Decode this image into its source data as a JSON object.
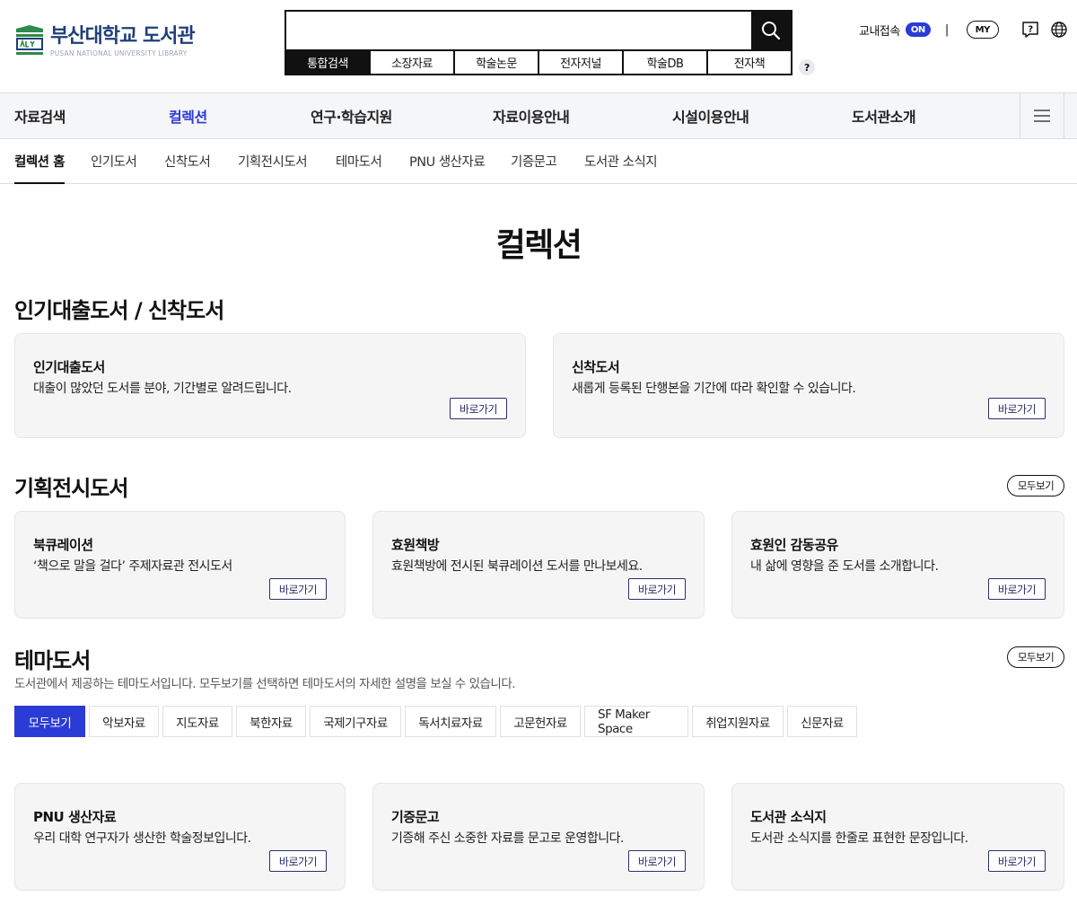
{
  "header": {
    "logo_title": "부산대학교 도서관",
    "logo_subtitle": "PUSAN NATIONAL UNIVERSITY LIBRARY",
    "search": {
      "value": "",
      "placeholder": "",
      "tabs": [
        "통합검색",
        "소장자료",
        "학술논문",
        "전자저널",
        "학술DB",
        "전자책"
      ],
      "active_tab": "통합검색",
      "help": "?"
    },
    "utils": {
      "campus_label": "교내접속",
      "campus_status": "ON",
      "separator": "|",
      "my_label": "MY"
    }
  },
  "gnb": {
    "items": [
      "자료검색",
      "컬렉션",
      "연구·학습지원",
      "자료이용안내",
      "시설이용안내",
      "도서관소개"
    ],
    "active": "컬렉션"
  },
  "subnav": {
    "items": [
      "컬렉션 홈",
      "인기도서",
      "신착도서",
      "기획전시도서",
      "테마도서",
      "PNU 생산자료",
      "기증문고",
      "도서관 소식지"
    ],
    "active": "컬렉션 홈"
  },
  "page": {
    "title": "컬렉션",
    "go_label": "바로가기",
    "more_label": "모두보기"
  },
  "popular_new": {
    "title": "인기대출도서 / 신착도서",
    "cards": [
      {
        "title": "인기대출도서",
        "desc": "대출이 많았던 도서를 분야, 기간별로 알려드립니다."
      },
      {
        "title": "신착도서",
        "desc": "새롭게 등록된 단행본을 기간에 따라 확인할 수 있습니다."
      }
    ]
  },
  "exhibition": {
    "title": "기획전시도서",
    "cards": [
      {
        "title": "북큐레이션",
        "desc": "‘책으로 말을 걸다’ 주제자료관 전시도서"
      },
      {
        "title": "효원책방",
        "desc": "효원책방에 전시된 북큐레이션 도서를 만나보세요."
      },
      {
        "title": "효원인 감동공유",
        "desc": "내 삶에 영향을 준 도서를 소개합니다."
      }
    ]
  },
  "theme": {
    "title": "테마도서",
    "desc": "도서관에서 제공하는 테마도서입니다. 모두보기를 선택하면 테마도서의 자세한 설명을 보실 수 있습니다.",
    "filters": [
      "모두보기",
      "악보자료",
      "지도자료",
      "북한자료",
      "국제기구자료",
      "독서치료자료",
      "고문헌자료",
      "SF Maker Space",
      "취업지원자료",
      "신문자료"
    ],
    "active_filter": "모두보기"
  },
  "bottom_cards": [
    {
      "title": "PNU 생산자료",
      "desc": "우리 대학 연구자가 생산한 학술정보입니다."
    },
    {
      "title": "기증문고",
      "desc": "기증해 주신 소중한 자료를 문고로 운영합니다."
    },
    {
      "title": "도서관 소식지",
      "desc": "도서관 소식지를 한줄로 표현한 문장입니다."
    }
  ],
  "colors": {
    "accent": "#2b3bd6",
    "logo": "#1f3f7a",
    "card_bg": "#f5f5f6",
    "go_border": "#2a2f6e"
  },
  "icons": [
    "pnu-logo-icon",
    "search-icon",
    "help-icon",
    "chat-help-icon",
    "globe-icon",
    "hamburger-menu-icon"
  ]
}
